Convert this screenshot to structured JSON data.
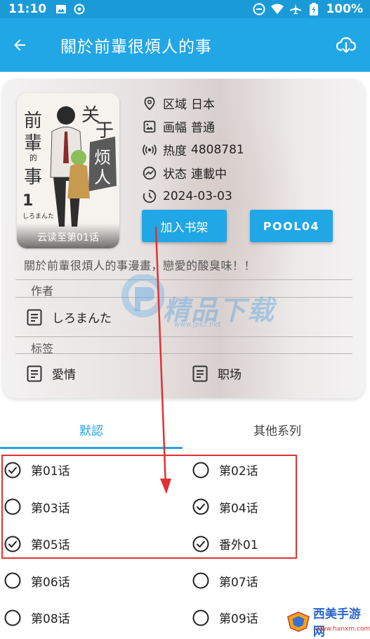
{
  "status_bar": {
    "time": "11:10",
    "battery": "100%"
  },
  "app_bar": {
    "title": "關於前輩很煩人的事"
  },
  "cover": {
    "caption": "云读至第01话"
  },
  "meta": {
    "region_label": "区域",
    "region_value": "日本",
    "style_label": "画幅",
    "style_value": "普通",
    "heat_label": "热度",
    "heat_value": "4808781",
    "state_label": "状态",
    "state_value": "連載中",
    "date_value": "2024-03-03"
  },
  "buttons": {
    "shelf": "加入书架",
    "pool": "POOL04"
  },
  "description": "關於前輩很煩人的事漫畫，戀愛的酸臭味！！",
  "author_section": {
    "label": "作者",
    "name": "しろまんた"
  },
  "tag_section": {
    "label": "标签",
    "tags": [
      "愛情",
      "职场"
    ]
  },
  "watermark": {
    "text": "精品下载",
    "url": "www.jpxz.net"
  },
  "tabs": {
    "default": "默認",
    "other": "其他系列"
  },
  "chapters": [
    {
      "label": "第01话",
      "checked": true
    },
    {
      "label": "第02话",
      "checked": false
    },
    {
      "label": "第03话",
      "checked": false
    },
    {
      "label": "第04话",
      "checked": true
    },
    {
      "label": "第05话",
      "checked": true
    },
    {
      "label": "番外01",
      "checked": true
    },
    {
      "label": "第06话",
      "checked": false
    },
    {
      "label": "第07话",
      "checked": false
    },
    {
      "label": "第08话",
      "checked": false
    },
    {
      "label": "第09话",
      "checked": false
    }
  ],
  "corner_logo": {
    "text": "西美手游网",
    "url": "www.hanxm.com"
  },
  "colors": {
    "accent": "#21a6e6",
    "status": "#1a9bd8",
    "annotation": "#e03232"
  }
}
